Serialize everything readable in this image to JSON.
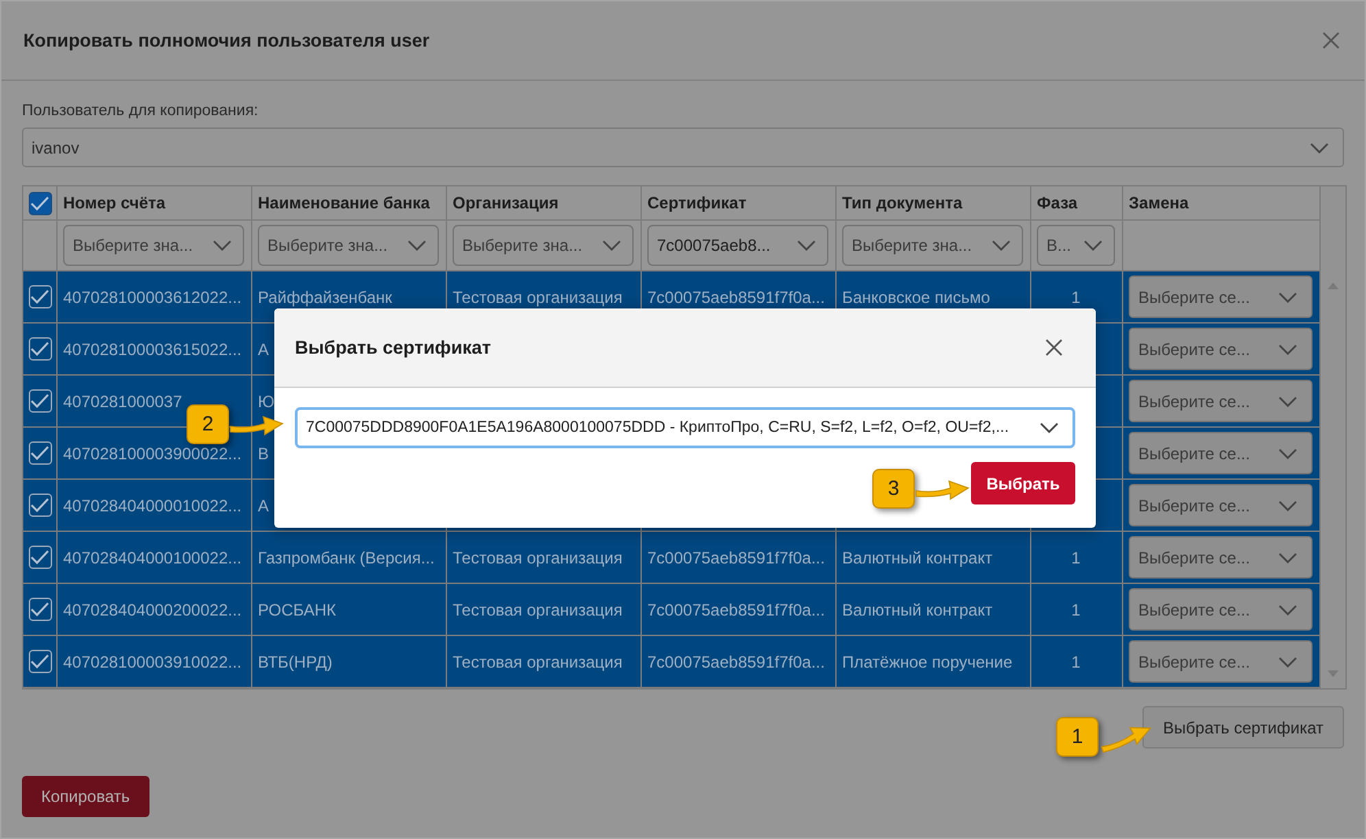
{
  "dialog": {
    "title": "Копировать полномочия пользователя user",
    "user_field": {
      "label": "Пользователь для копирования:",
      "value": "ivanov"
    },
    "table": {
      "all_checked": true,
      "columns": [
        {
          "label": "Номер счёта",
          "filter": {
            "placeholder": "Выберите зна..."
          }
        },
        {
          "label": "Наименование банка",
          "filter": {
            "placeholder": "Выберите зна..."
          }
        },
        {
          "label": "Организация",
          "filter": {
            "placeholder": "Выберите зна..."
          }
        },
        {
          "label": "Сертификат",
          "filter": {
            "value": "7c00075aeb8..."
          }
        },
        {
          "label": "Тип документа",
          "filter": {
            "placeholder": "Выберите зна..."
          }
        },
        {
          "label": "Фаза",
          "filter": {
            "placeholder": "В..."
          }
        },
        {
          "label": "Замена"
        }
      ],
      "rows": [
        {
          "checked": true,
          "selected": true,
          "cells": [
            "407028100003612022...",
            "Райффайзенбанк",
            "Тестовая организация",
            "7c00075aeb8591f7f0a...",
            "Банковское письмо",
            "1"
          ],
          "replacement": "Выберите се..."
        },
        {
          "checked": true,
          "selected": true,
          "cells": [
            "407028100003615022...",
            "А"
          ],
          "replacement": "Выберите се..."
        },
        {
          "checked": true,
          "selected": true,
          "cells": [
            "4070281000037",
            "Ю"
          ],
          "replacement": "Выберите се..."
        },
        {
          "checked": true,
          "selected": true,
          "cells": [
            "407028100003900022...",
            "В"
          ],
          "replacement": "Выберите се..."
        },
        {
          "checked": true,
          "selected": true,
          "cells": [
            "407028404000010022...",
            "А"
          ],
          "replacement": "Выберите се..."
        },
        {
          "checked": true,
          "selected": true,
          "cells": [
            "407028404000100022...",
            "Газпромбанк (Версия...",
            "Тестовая организация",
            "7c00075aeb8591f7f0a...",
            "Валютный контракт",
            "1"
          ],
          "replacement": "Выберите се..."
        },
        {
          "checked": true,
          "selected": true,
          "cells": [
            "407028404000200022...",
            "РОСБАНК",
            "Тестовая организация",
            "7c00075aeb8591f7f0a...",
            "Валютный контракт",
            "1"
          ],
          "replacement": "Выберите се..."
        },
        {
          "checked": true,
          "selected": true,
          "cells": [
            "407028100003910022...",
            "ВТБ(НРД)",
            "Тестовая организация",
            "7c00075aeb8591f7f0a...",
            "Платёжное поручение",
            "1"
          ],
          "replacement": "Выберите се..."
        }
      ]
    },
    "select_button": "Выбрать сертификат",
    "copy_button": "Копировать"
  },
  "modal": {
    "title": "Выбрать сертификат",
    "certificate": "7C00075DDD8900F0A1E5A196A8000100075DDD - КриптоПро, C=RU, S=f2, L=f2, O=f2, OU=f2,...",
    "ok_button": "Выбрать"
  },
  "callouts": [
    {
      "number": "1"
    },
    {
      "number": "2"
    },
    {
      "number": "3"
    }
  ]
}
